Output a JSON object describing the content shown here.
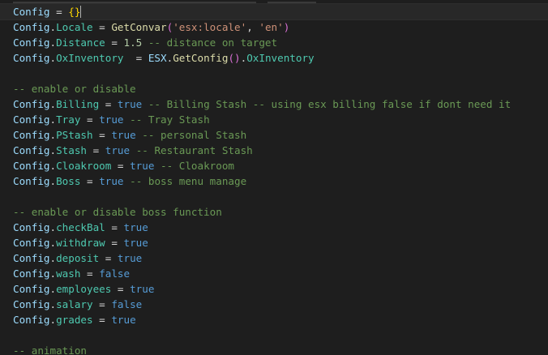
{
  "editor": {
    "lines": [
      [
        {
          "t": "Config",
          "c": "var"
        },
        {
          "t": " = ",
          "c": "op"
        },
        {
          "t": "{}",
          "c": "brace"
        }
      ],
      [
        {
          "t": "Config",
          "c": "var"
        },
        {
          "t": ".",
          "c": "punc"
        },
        {
          "t": "Locale",
          "c": "prop"
        },
        {
          "t": " = ",
          "c": "op"
        },
        {
          "t": "GetConvar",
          "c": "fn"
        },
        {
          "t": "(",
          "c": "paren"
        },
        {
          "t": "'esx:locale'",
          "c": "str"
        },
        {
          "t": ", ",
          "c": "punc"
        },
        {
          "t": "'en'",
          "c": "str"
        },
        {
          "t": ")",
          "c": "paren"
        }
      ],
      [
        {
          "t": "Config",
          "c": "var"
        },
        {
          "t": ".",
          "c": "punc"
        },
        {
          "t": "Distance",
          "c": "prop"
        },
        {
          "t": " = ",
          "c": "op"
        },
        {
          "t": "1.5",
          "c": "num"
        },
        {
          "t": " -- distance on target",
          "c": "cmt"
        }
      ],
      [
        {
          "t": "Config",
          "c": "var"
        },
        {
          "t": ".",
          "c": "punc"
        },
        {
          "t": "OxInventory",
          "c": "prop"
        },
        {
          "t": "  = ",
          "c": "op"
        },
        {
          "t": "ESX",
          "c": "var"
        },
        {
          "t": ".",
          "c": "punc"
        },
        {
          "t": "GetConfig",
          "c": "fn"
        },
        {
          "t": "()",
          "c": "paren"
        },
        {
          "t": ".",
          "c": "punc"
        },
        {
          "t": "OxInventory",
          "c": "prop"
        }
      ],
      [],
      [
        {
          "t": "-- enable or disable",
          "c": "cmt"
        }
      ],
      [
        {
          "t": "Config",
          "c": "var"
        },
        {
          "t": ".",
          "c": "punc"
        },
        {
          "t": "Billing",
          "c": "prop"
        },
        {
          "t": " = ",
          "c": "op"
        },
        {
          "t": "true",
          "c": "kw"
        },
        {
          "t": " -- Billing Stash -- using esx billing false if dont need it",
          "c": "cmt"
        }
      ],
      [
        {
          "t": "Config",
          "c": "var"
        },
        {
          "t": ".",
          "c": "punc"
        },
        {
          "t": "Tray",
          "c": "prop"
        },
        {
          "t": " = ",
          "c": "op"
        },
        {
          "t": "true",
          "c": "kw"
        },
        {
          "t": " -- Tray Stash",
          "c": "cmt"
        }
      ],
      [
        {
          "t": "Config",
          "c": "var"
        },
        {
          "t": ".",
          "c": "punc"
        },
        {
          "t": "PStash",
          "c": "prop"
        },
        {
          "t": " = ",
          "c": "op"
        },
        {
          "t": "true",
          "c": "kw"
        },
        {
          "t": " -- personal Stash",
          "c": "cmt"
        }
      ],
      [
        {
          "t": "Config",
          "c": "var"
        },
        {
          "t": ".",
          "c": "punc"
        },
        {
          "t": "Stash",
          "c": "prop"
        },
        {
          "t": " = ",
          "c": "op"
        },
        {
          "t": "true",
          "c": "kw"
        },
        {
          "t": " -- Restaurant Stash",
          "c": "cmt"
        }
      ],
      [
        {
          "t": "Config",
          "c": "var"
        },
        {
          "t": ".",
          "c": "punc"
        },
        {
          "t": "Cloakroom",
          "c": "prop"
        },
        {
          "t": " = ",
          "c": "op"
        },
        {
          "t": "true",
          "c": "kw"
        },
        {
          "t": " -- Cloakroom",
          "c": "cmt"
        }
      ],
      [
        {
          "t": "Config",
          "c": "var"
        },
        {
          "t": ".",
          "c": "punc"
        },
        {
          "t": "Boss",
          "c": "prop"
        },
        {
          "t": " = ",
          "c": "op"
        },
        {
          "t": "true",
          "c": "kw"
        },
        {
          "t": " -- boss menu manage",
          "c": "cmt"
        }
      ],
      [],
      [
        {
          "t": "-- enable or disable boss function",
          "c": "cmt"
        }
      ],
      [
        {
          "t": "Config",
          "c": "var"
        },
        {
          "t": ".",
          "c": "punc"
        },
        {
          "t": "checkBal",
          "c": "prop"
        },
        {
          "t": " = ",
          "c": "op"
        },
        {
          "t": "true",
          "c": "kw"
        }
      ],
      [
        {
          "t": "Config",
          "c": "var"
        },
        {
          "t": ".",
          "c": "punc"
        },
        {
          "t": "withdraw",
          "c": "prop"
        },
        {
          "t": " = ",
          "c": "op"
        },
        {
          "t": "true",
          "c": "kw"
        }
      ],
      [
        {
          "t": "Config",
          "c": "var"
        },
        {
          "t": ".",
          "c": "punc"
        },
        {
          "t": "deposit",
          "c": "prop"
        },
        {
          "t": " = ",
          "c": "op"
        },
        {
          "t": "true",
          "c": "kw"
        }
      ],
      [
        {
          "t": "Config",
          "c": "var"
        },
        {
          "t": ".",
          "c": "punc"
        },
        {
          "t": "wash",
          "c": "prop"
        },
        {
          "t": " = ",
          "c": "op"
        },
        {
          "t": "false",
          "c": "kw"
        }
      ],
      [
        {
          "t": "Config",
          "c": "var"
        },
        {
          "t": ".",
          "c": "punc"
        },
        {
          "t": "employees",
          "c": "prop"
        },
        {
          "t": " = ",
          "c": "op"
        },
        {
          "t": "true",
          "c": "kw"
        }
      ],
      [
        {
          "t": "Config",
          "c": "var"
        },
        {
          "t": ".",
          "c": "punc"
        },
        {
          "t": "salary",
          "c": "prop"
        },
        {
          "t": " = ",
          "c": "op"
        },
        {
          "t": "false",
          "c": "kw"
        }
      ],
      [
        {
          "t": "Config",
          "c": "var"
        },
        {
          "t": ".",
          "c": "punc"
        },
        {
          "t": "grades",
          "c": "prop"
        },
        {
          "t": " = ",
          "c": "op"
        },
        {
          "t": "true",
          "c": "kw"
        }
      ],
      [],
      [
        {
          "t": "-- animation",
          "c": "cmt"
        }
      ]
    ],
    "cursor_line": 0
  }
}
